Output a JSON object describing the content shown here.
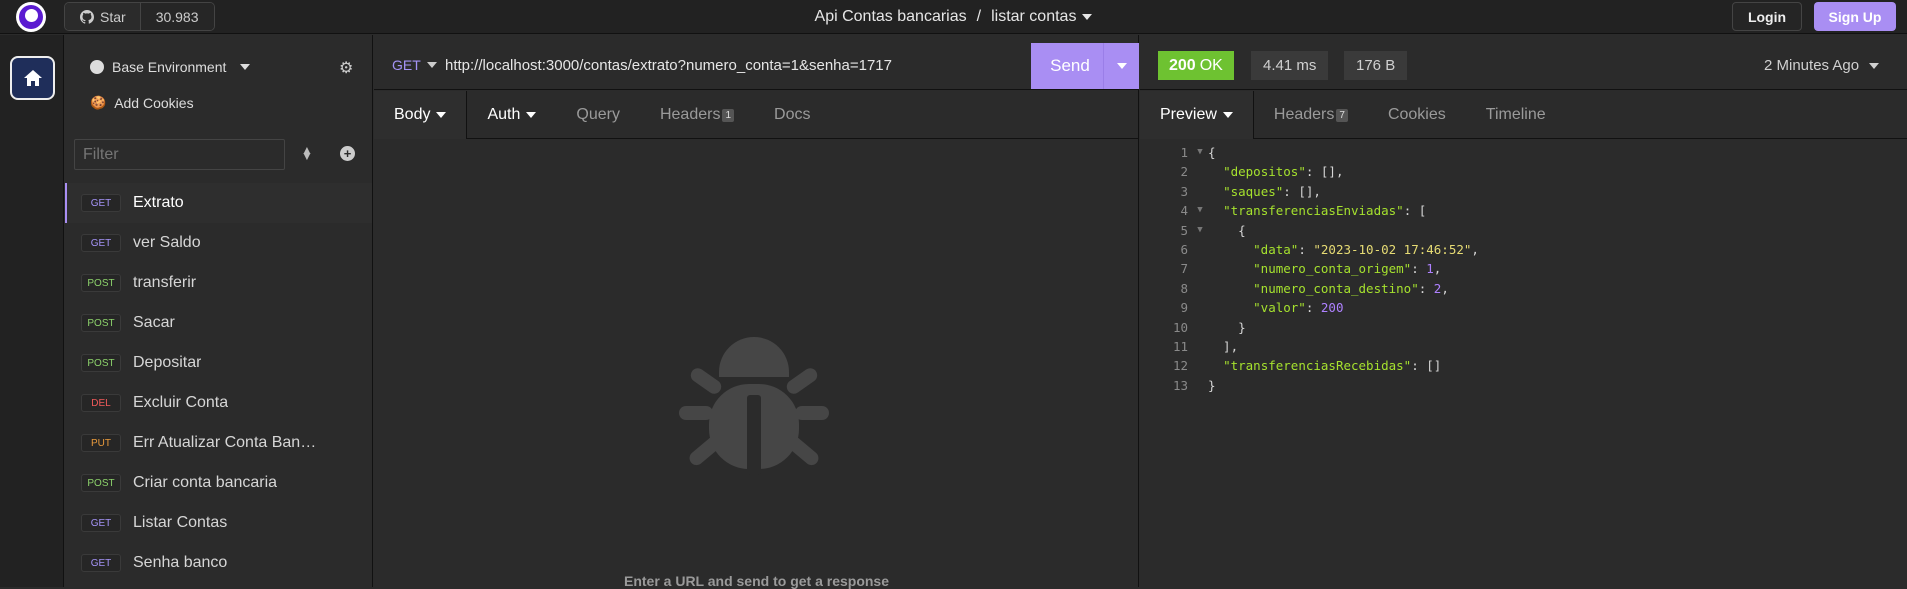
{
  "topbar": {
    "star_label": "Star",
    "star_count": "30.983",
    "workspace": "Api Contas bancarias",
    "separator": "/",
    "collection": "listar contas",
    "login": "Login",
    "signup": "Sign Up"
  },
  "sidebar": {
    "environment": "Base Environment",
    "add_cookies": "Add Cookies",
    "filter_placeholder": "Filter",
    "requests": [
      {
        "method": "GET",
        "label": "Extrato"
      },
      {
        "method": "GET",
        "label": "ver Saldo"
      },
      {
        "method": "POST",
        "label": "transferir"
      },
      {
        "method": "POST",
        "label": "Sacar"
      },
      {
        "method": "POST",
        "label": "Depositar"
      },
      {
        "method": "DEL",
        "label": "Excluir Conta"
      },
      {
        "method": "PUT",
        "label": "Err Atualizar Conta Bancaria"
      },
      {
        "method": "POST",
        "label": "Criar conta bancaria"
      },
      {
        "method": "GET",
        "label": "Listar Contas"
      },
      {
        "method": "GET",
        "label": "Senha banco"
      }
    ]
  },
  "request": {
    "method": "GET",
    "url": "http://localhost:3000/contas/extrato?numero_conta=1&senha=1717",
    "send": "Send",
    "tabs": {
      "body": "Body",
      "auth": "Auth",
      "query": "Query",
      "headers": "Headers",
      "headers_count": "1",
      "docs": "Docs"
    },
    "empty_hint": "Enter a URL and send to get a response"
  },
  "response": {
    "status_code": "200",
    "status_text": "OK",
    "time": "4.41 ms",
    "size": "176 B",
    "ago": "2 Minutes Ago",
    "tabs": {
      "preview": "Preview",
      "headers": "Headers",
      "headers_count": "7",
      "cookies": "Cookies",
      "timeline": "Timeline"
    },
    "lines": [
      {
        "n": "1",
        "fold": true,
        "segs": [
          [
            "p",
            "{"
          ]
        ]
      },
      {
        "n": "2",
        "segs": [
          [
            "p",
            "  "
          ],
          [
            "k",
            "\"depositos\""
          ],
          [
            "p",
            ": [],"
          ]
        ]
      },
      {
        "n": "3",
        "segs": [
          [
            "p",
            "  "
          ],
          [
            "k",
            "\"saques\""
          ],
          [
            "p",
            ": [],"
          ]
        ]
      },
      {
        "n": "4",
        "fold": true,
        "segs": [
          [
            "p",
            "  "
          ],
          [
            "k",
            "\"transferenciasEnviadas\""
          ],
          [
            "p",
            ": ["
          ]
        ]
      },
      {
        "n": "5",
        "fold": true,
        "segs": [
          [
            "p",
            "    {"
          ]
        ]
      },
      {
        "n": "6",
        "segs": [
          [
            "p",
            "      "
          ],
          [
            "k",
            "\"data\""
          ],
          [
            "p",
            ": "
          ],
          [
            "s",
            "\"2023-10-02 17:46:52\""
          ],
          [
            "p",
            ","
          ]
        ]
      },
      {
        "n": "7",
        "segs": [
          [
            "p",
            "      "
          ],
          [
            "k",
            "\"numero_conta_origem\""
          ],
          [
            "p",
            ": "
          ],
          [
            "n",
            "1"
          ],
          [
            "p",
            ","
          ]
        ]
      },
      {
        "n": "8",
        "segs": [
          [
            "p",
            "      "
          ],
          [
            "k",
            "\"numero_conta_destino\""
          ],
          [
            "p",
            ": "
          ],
          [
            "n",
            "2"
          ],
          [
            "p",
            ","
          ]
        ]
      },
      {
        "n": "9",
        "segs": [
          [
            "p",
            "      "
          ],
          [
            "k",
            "\"valor\""
          ],
          [
            "p",
            ": "
          ],
          [
            "n",
            "200"
          ]
        ]
      },
      {
        "n": "10",
        "segs": [
          [
            "p",
            "    }"
          ]
        ]
      },
      {
        "n": "11",
        "segs": [
          [
            "p",
            "  ],"
          ]
        ]
      },
      {
        "n": "12",
        "segs": [
          [
            "p",
            "  "
          ],
          [
            "k",
            "\"transferenciasRecebidas\""
          ],
          [
            "p",
            ": []"
          ]
        ]
      },
      {
        "n": "13",
        "segs": [
          [
            "p",
            "}"
          ]
        ]
      }
    ]
  }
}
